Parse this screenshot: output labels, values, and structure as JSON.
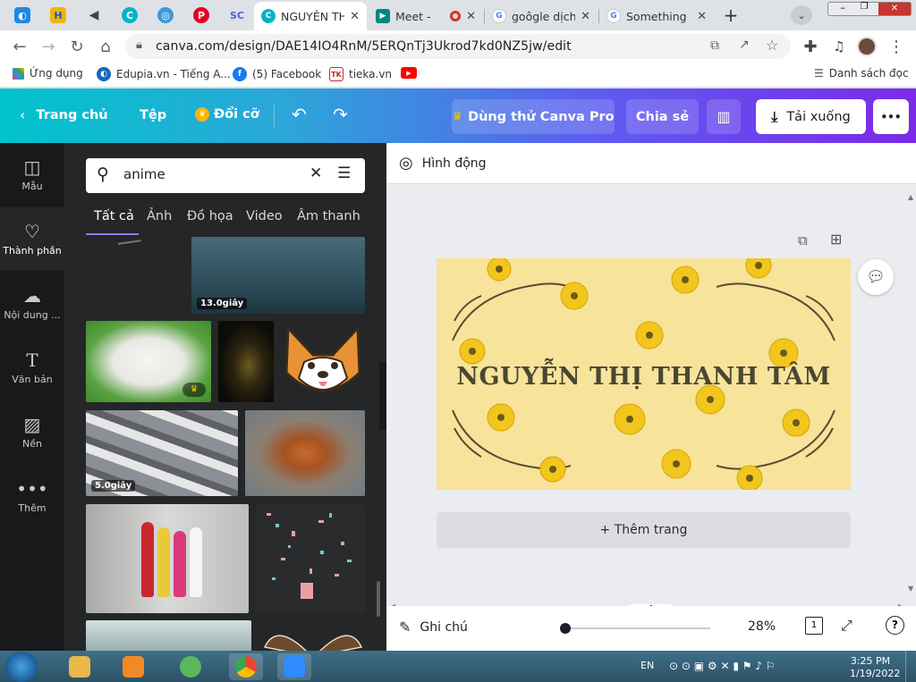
{
  "browser": {
    "tabs": [
      {
        "title": "NGUYỄN TH",
        "active": true
      },
      {
        "title": "Meet -",
        "active": false
      },
      {
        "title": "goôgle dịch",
        "active": false
      },
      {
        "title": "Something",
        "active": false
      }
    ],
    "new_tab": "+",
    "url": "canva.com/design/DAE14IO4RnM/5ERQnTj3Ukrod7kd0NZ5jw/edit",
    "bookmarks": [
      {
        "label": "Ứng dụng"
      },
      {
        "label": "Edupia.vn - Tiếng A..."
      },
      {
        "label": "(5) Facebook"
      },
      {
        "label": "tieka.vn"
      }
    ],
    "reading_list": "Danh sách đọc"
  },
  "header": {
    "home": "Trang chủ",
    "file": "Tệp",
    "resize": "Đổi cỡ",
    "try_pro": "Dùng thử Canva Pro",
    "share": "Chia sẻ",
    "download": "Tải xuống",
    "more": "•••"
  },
  "rail": [
    {
      "label": "Mẫu"
    },
    {
      "label": "Thành phần"
    },
    {
      "label": "Nội dung ..."
    },
    {
      "label": "Văn bản"
    },
    {
      "label": "Nền"
    },
    {
      "label": "Thêm"
    }
  ],
  "panel": {
    "search_value": "anime",
    "filter_tabs": [
      "Tất cả",
      "Ảnh",
      "Đồ họa",
      "Video",
      "Âm thanh"
    ],
    "durations": [
      "13.0giây",
      "5.0giây"
    ]
  },
  "editor": {
    "animate": "Hình động",
    "page_title": "NGUYỄN THỊ THANH TÂM",
    "add_page": "+ Thêm trang",
    "notes": "Ghi chú",
    "zoom": "28%",
    "zoom_fraction": 0.0,
    "page_count": "1"
  },
  "taskbar": {
    "lang": "EN",
    "time": "3:25 PM",
    "date": "1/19/2022"
  },
  "colors": {
    "brand_start": "#00c4cc",
    "brand_end": "#7c2ae8",
    "panel_bg": "#252627",
    "rail_bg": "#18191b",
    "design_bg": "#f7e39a"
  }
}
